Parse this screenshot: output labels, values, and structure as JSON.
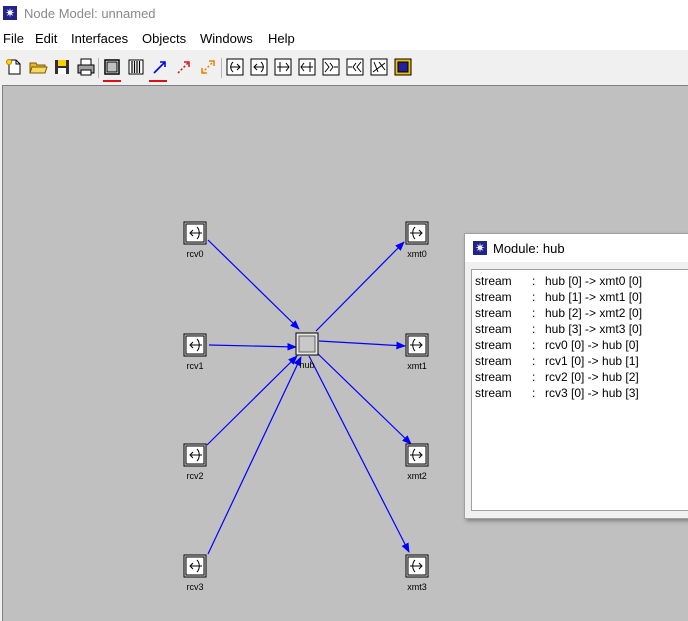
{
  "window": {
    "title": "Node Model: unnamed",
    "icon": "opnet-star-icon"
  },
  "menu": [
    "File",
    "Edit",
    "Interfaces",
    "Objects",
    "Windows",
    "Help"
  ],
  "toolbar": {
    "items": [
      "new-icon",
      "open-folder-icon",
      "save-icon",
      "print-icon",
      "module-icon",
      "stream-bus-icon",
      "packet-stream-icon",
      "stat-wire-icon",
      "logical-tx-rx-icon",
      "transmitter-icon",
      "receiver-icon",
      "bus-transmitter-icon",
      "bus-receiver-icon",
      "radio-transmitter-icon",
      "radio-receiver-icon",
      "antenna-icon",
      "external-system-icon"
    ]
  },
  "nodes": [
    {
      "id": "rcv0",
      "label": "rcv0",
      "type": "receiver"
    },
    {
      "id": "rcv1",
      "label": "rcv1",
      "type": "receiver"
    },
    {
      "id": "rcv2",
      "label": "rcv2",
      "type": "receiver"
    },
    {
      "id": "rcv3",
      "label": "rcv3",
      "type": "receiver"
    },
    {
      "id": "hub",
      "label": "hub",
      "type": "processor"
    },
    {
      "id": "xmt0",
      "label": "xmt0",
      "type": "transmitter"
    },
    {
      "id": "xmt1",
      "label": "xmt1",
      "type": "transmitter"
    },
    {
      "id": "xmt2",
      "label": "xmt2",
      "type": "transmitter"
    },
    {
      "id": "xmt3",
      "label": "xmt3",
      "type": "transmitter"
    }
  ],
  "dialog": {
    "title": "Module: hub",
    "rows": [
      {
        "kind": "stream",
        "sep": ":",
        "desc": "hub [0] -> xmt0 [0]"
      },
      {
        "kind": "stream",
        "sep": ":",
        "desc": "hub [1] -> xmt1 [0]"
      },
      {
        "kind": "stream",
        "sep": ":",
        "desc": "hub [2] -> xmt2 [0]"
      },
      {
        "kind": "stream",
        "sep": ":",
        "desc": "hub [3] -> xmt3 [0]"
      },
      {
        "kind": "stream",
        "sep": ":",
        "desc": "rcv0 [0] -> hub [0]"
      },
      {
        "kind": "stream",
        "sep": ":",
        "desc": "rcv1 [0] -> hub [1]"
      },
      {
        "kind": "stream",
        "sep": ":",
        "desc": "rcv2 [0] -> hub [2]"
      },
      {
        "kind": "stream",
        "sep": ":",
        "desc": "rcv3 [0] -> hub [3]"
      }
    ]
  },
  "colors": {
    "canvas": "#c0c0c0",
    "stream": "#0000ff",
    "accent_underline": "#e01010"
  }
}
